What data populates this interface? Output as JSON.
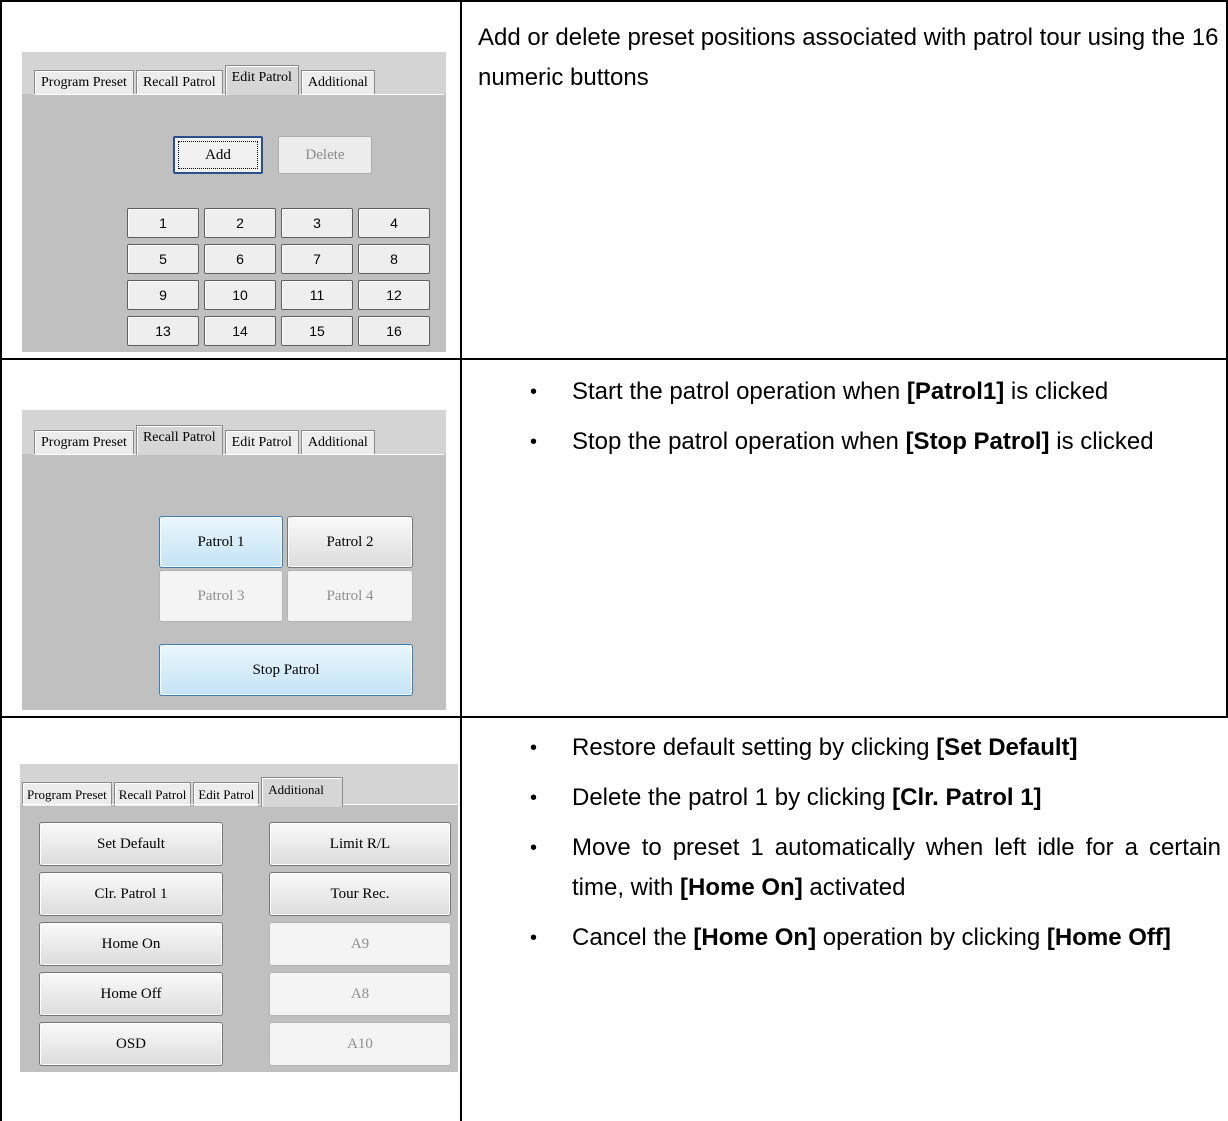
{
  "rows": [
    {
      "screenshot": {
        "tabs": [
          "Program Preset",
          "Recall Patrol",
          "Edit Patrol",
          "Additional"
        ],
        "active_tab": "Edit Patrol",
        "add_label": "Add",
        "delete_label": "Delete",
        "numbers": [
          "1",
          "2",
          "3",
          "4",
          "5",
          "6",
          "7",
          "8",
          "9",
          "10",
          "11",
          "12",
          "13",
          "14",
          "15",
          "16"
        ]
      },
      "description": "Add or delete preset positions associated with patrol tour using the 16 numeric buttons"
    },
    {
      "screenshot": {
        "tabs": [
          "Program Preset",
          "Recall Patrol",
          "Edit Patrol",
          "Additional"
        ],
        "active_tab": "Recall Patrol",
        "patrol_buttons": [
          "Patrol 1",
          "Patrol 2",
          "Patrol 3",
          "Patrol 4"
        ],
        "stop_label": "Stop Patrol"
      },
      "bullets": [
        {
          "before": "Start the patrol operation when ",
          "bold": "[Patrol1]",
          "after": " is clicked"
        },
        {
          "before": "Stop the patrol operation when ",
          "bold": "[Stop Patrol]",
          "after": " is clicked"
        }
      ]
    },
    {
      "screenshot": {
        "tabs": [
          "Program Preset",
          "Recall Patrol",
          "Edit Patrol",
          "Additional"
        ],
        "active_tab": "Additional",
        "left_buttons": [
          "Set Default",
          "Clr. Patrol 1",
          "Home On",
          "Home Off",
          "OSD"
        ],
        "right_buttons": [
          "Limit R/L",
          "Tour Rec.",
          "A9",
          "A8",
          "A10"
        ]
      },
      "bullets": [
        {
          "before": "Restore default setting by clicking ",
          "bold": "[Set Default]",
          "after": ""
        },
        {
          "before": "Delete the patrol 1 by clicking ",
          "bold": "[Clr. Patrol 1]",
          "after": ""
        },
        {
          "before": "Move to preset 1 automatically when left idle for a certain time, with ",
          "bold": "[Home On]",
          "after": " activated"
        },
        {
          "before": "Cancel the ",
          "bold": "[Home On]",
          "after": " operation by clicking ",
          "bold2": "[Home Off]"
        }
      ]
    }
  ]
}
